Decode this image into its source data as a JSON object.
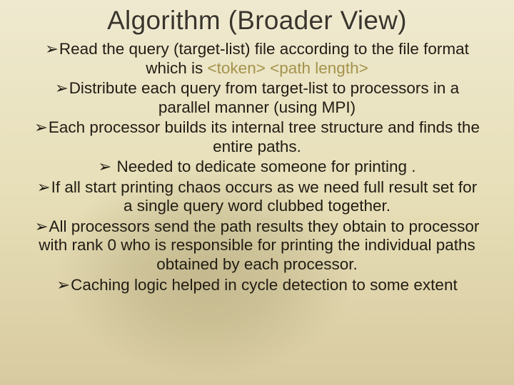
{
  "title": "Algorithm (Broader View)",
  "bullet_glyph": "➢",
  "items": [
    {
      "pre": "Read the query (target-list) file according to the file format which is ",
      "hl": "<token> <path length>",
      "post": ""
    },
    {
      "pre": "Distribute each query from target-list to processors in a parallel manner (using MPI)",
      "hl": "",
      "post": ""
    },
    {
      "pre": "Each processor builds its internal tree structure and finds the entire paths.",
      "hl": "",
      "post": ""
    },
    {
      "pre": " Needed to dedicate someone for printing .",
      "hl": "",
      "post": ""
    },
    {
      "pre": "If all start printing chaos occurs as we need full result set for a single query word clubbed together.",
      "hl": "",
      "post": ""
    },
    {
      "pre": "All processors send the path results they obtain to processor with rank 0 who is responsible for printing the individual paths obtained by each processor.",
      "hl": "",
      "post": ""
    },
    {
      "pre": "Caching logic helped in cycle detection to some extent",
      "hl": "",
      "post": ""
    }
  ]
}
